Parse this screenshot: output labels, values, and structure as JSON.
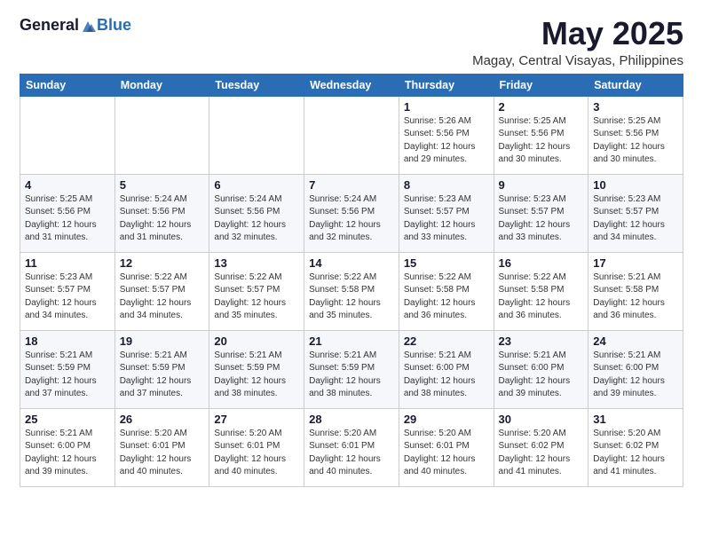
{
  "logo": {
    "general": "General",
    "blue": "Blue"
  },
  "title": {
    "month": "May 2025",
    "location": "Magay, Central Visayas, Philippines"
  },
  "headers": [
    "Sunday",
    "Monday",
    "Tuesday",
    "Wednesday",
    "Thursday",
    "Friday",
    "Saturday"
  ],
  "weeks": [
    [
      {
        "day": "",
        "info": ""
      },
      {
        "day": "",
        "info": ""
      },
      {
        "day": "",
        "info": ""
      },
      {
        "day": "",
        "info": ""
      },
      {
        "day": "1",
        "info": "Sunrise: 5:26 AM\nSunset: 5:56 PM\nDaylight: 12 hours\nand 29 minutes."
      },
      {
        "day": "2",
        "info": "Sunrise: 5:25 AM\nSunset: 5:56 PM\nDaylight: 12 hours\nand 30 minutes."
      },
      {
        "day": "3",
        "info": "Sunrise: 5:25 AM\nSunset: 5:56 PM\nDaylight: 12 hours\nand 30 minutes."
      }
    ],
    [
      {
        "day": "4",
        "info": "Sunrise: 5:25 AM\nSunset: 5:56 PM\nDaylight: 12 hours\nand 31 minutes."
      },
      {
        "day": "5",
        "info": "Sunrise: 5:24 AM\nSunset: 5:56 PM\nDaylight: 12 hours\nand 31 minutes."
      },
      {
        "day": "6",
        "info": "Sunrise: 5:24 AM\nSunset: 5:56 PM\nDaylight: 12 hours\nand 32 minutes."
      },
      {
        "day": "7",
        "info": "Sunrise: 5:24 AM\nSunset: 5:56 PM\nDaylight: 12 hours\nand 32 minutes."
      },
      {
        "day": "8",
        "info": "Sunrise: 5:23 AM\nSunset: 5:57 PM\nDaylight: 12 hours\nand 33 minutes."
      },
      {
        "day": "9",
        "info": "Sunrise: 5:23 AM\nSunset: 5:57 PM\nDaylight: 12 hours\nand 33 minutes."
      },
      {
        "day": "10",
        "info": "Sunrise: 5:23 AM\nSunset: 5:57 PM\nDaylight: 12 hours\nand 34 minutes."
      }
    ],
    [
      {
        "day": "11",
        "info": "Sunrise: 5:23 AM\nSunset: 5:57 PM\nDaylight: 12 hours\nand 34 minutes."
      },
      {
        "day": "12",
        "info": "Sunrise: 5:22 AM\nSunset: 5:57 PM\nDaylight: 12 hours\nand 34 minutes."
      },
      {
        "day": "13",
        "info": "Sunrise: 5:22 AM\nSunset: 5:57 PM\nDaylight: 12 hours\nand 35 minutes."
      },
      {
        "day": "14",
        "info": "Sunrise: 5:22 AM\nSunset: 5:58 PM\nDaylight: 12 hours\nand 35 minutes."
      },
      {
        "day": "15",
        "info": "Sunrise: 5:22 AM\nSunset: 5:58 PM\nDaylight: 12 hours\nand 36 minutes."
      },
      {
        "day": "16",
        "info": "Sunrise: 5:22 AM\nSunset: 5:58 PM\nDaylight: 12 hours\nand 36 minutes."
      },
      {
        "day": "17",
        "info": "Sunrise: 5:21 AM\nSunset: 5:58 PM\nDaylight: 12 hours\nand 36 minutes."
      }
    ],
    [
      {
        "day": "18",
        "info": "Sunrise: 5:21 AM\nSunset: 5:59 PM\nDaylight: 12 hours\nand 37 minutes."
      },
      {
        "day": "19",
        "info": "Sunrise: 5:21 AM\nSunset: 5:59 PM\nDaylight: 12 hours\nand 37 minutes."
      },
      {
        "day": "20",
        "info": "Sunrise: 5:21 AM\nSunset: 5:59 PM\nDaylight: 12 hours\nand 38 minutes."
      },
      {
        "day": "21",
        "info": "Sunrise: 5:21 AM\nSunset: 5:59 PM\nDaylight: 12 hours\nand 38 minutes."
      },
      {
        "day": "22",
        "info": "Sunrise: 5:21 AM\nSunset: 6:00 PM\nDaylight: 12 hours\nand 38 minutes."
      },
      {
        "day": "23",
        "info": "Sunrise: 5:21 AM\nSunset: 6:00 PM\nDaylight: 12 hours\nand 39 minutes."
      },
      {
        "day": "24",
        "info": "Sunrise: 5:21 AM\nSunset: 6:00 PM\nDaylight: 12 hours\nand 39 minutes."
      }
    ],
    [
      {
        "day": "25",
        "info": "Sunrise: 5:21 AM\nSunset: 6:00 PM\nDaylight: 12 hours\nand 39 minutes."
      },
      {
        "day": "26",
        "info": "Sunrise: 5:20 AM\nSunset: 6:01 PM\nDaylight: 12 hours\nand 40 minutes."
      },
      {
        "day": "27",
        "info": "Sunrise: 5:20 AM\nSunset: 6:01 PM\nDaylight: 12 hours\nand 40 minutes."
      },
      {
        "day": "28",
        "info": "Sunrise: 5:20 AM\nSunset: 6:01 PM\nDaylight: 12 hours\nand 40 minutes."
      },
      {
        "day": "29",
        "info": "Sunrise: 5:20 AM\nSunset: 6:01 PM\nDaylight: 12 hours\nand 40 minutes."
      },
      {
        "day": "30",
        "info": "Sunrise: 5:20 AM\nSunset: 6:02 PM\nDaylight: 12 hours\nand 41 minutes."
      },
      {
        "day": "31",
        "info": "Sunrise: 5:20 AM\nSunset: 6:02 PM\nDaylight: 12 hours\nand 41 minutes."
      }
    ]
  ]
}
